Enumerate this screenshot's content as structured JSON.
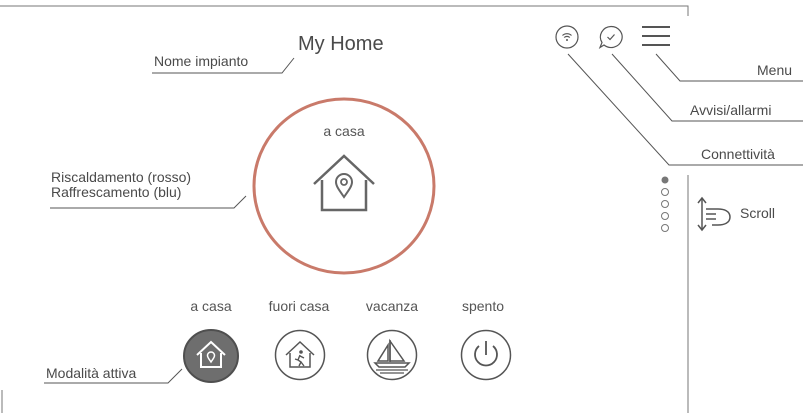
{
  "header": {
    "title": "My Home"
  },
  "top_icons": {
    "wifi": "wifi-icon",
    "alerts": "chat-check-icon",
    "menu": "hamburger-menu-icon"
  },
  "main": {
    "mode_label": "a casa",
    "mode_icon": "house-location-icon",
    "ring_color": "#c97a6a"
  },
  "modes": [
    {
      "label": "a casa",
      "icon": "house-location-icon",
      "active": true
    },
    {
      "label": "fuori casa",
      "icon": "person-leaving-house-icon",
      "active": false
    },
    {
      "label": "vacanza",
      "icon": "sailboat-icon",
      "active": false
    },
    {
      "label": "spento",
      "icon": "power-icon",
      "active": false
    }
  ],
  "callouts": {
    "system_name": "Nome impianto",
    "heating_line1": "Riscaldamento (rosso)",
    "heating_line2": "Raffrescamento (blu)",
    "active_mode": "Modalità attiva",
    "menu": "Menu",
    "alerts": "Avvisi/allarmi",
    "connectivity": "Connettività",
    "scroll": "Scroll"
  },
  "pagination": {
    "count": 5,
    "active_index": 0
  },
  "colors": {
    "ring": "#c97a6a",
    "active_button": "#6e6e6e",
    "line": "#555555"
  }
}
